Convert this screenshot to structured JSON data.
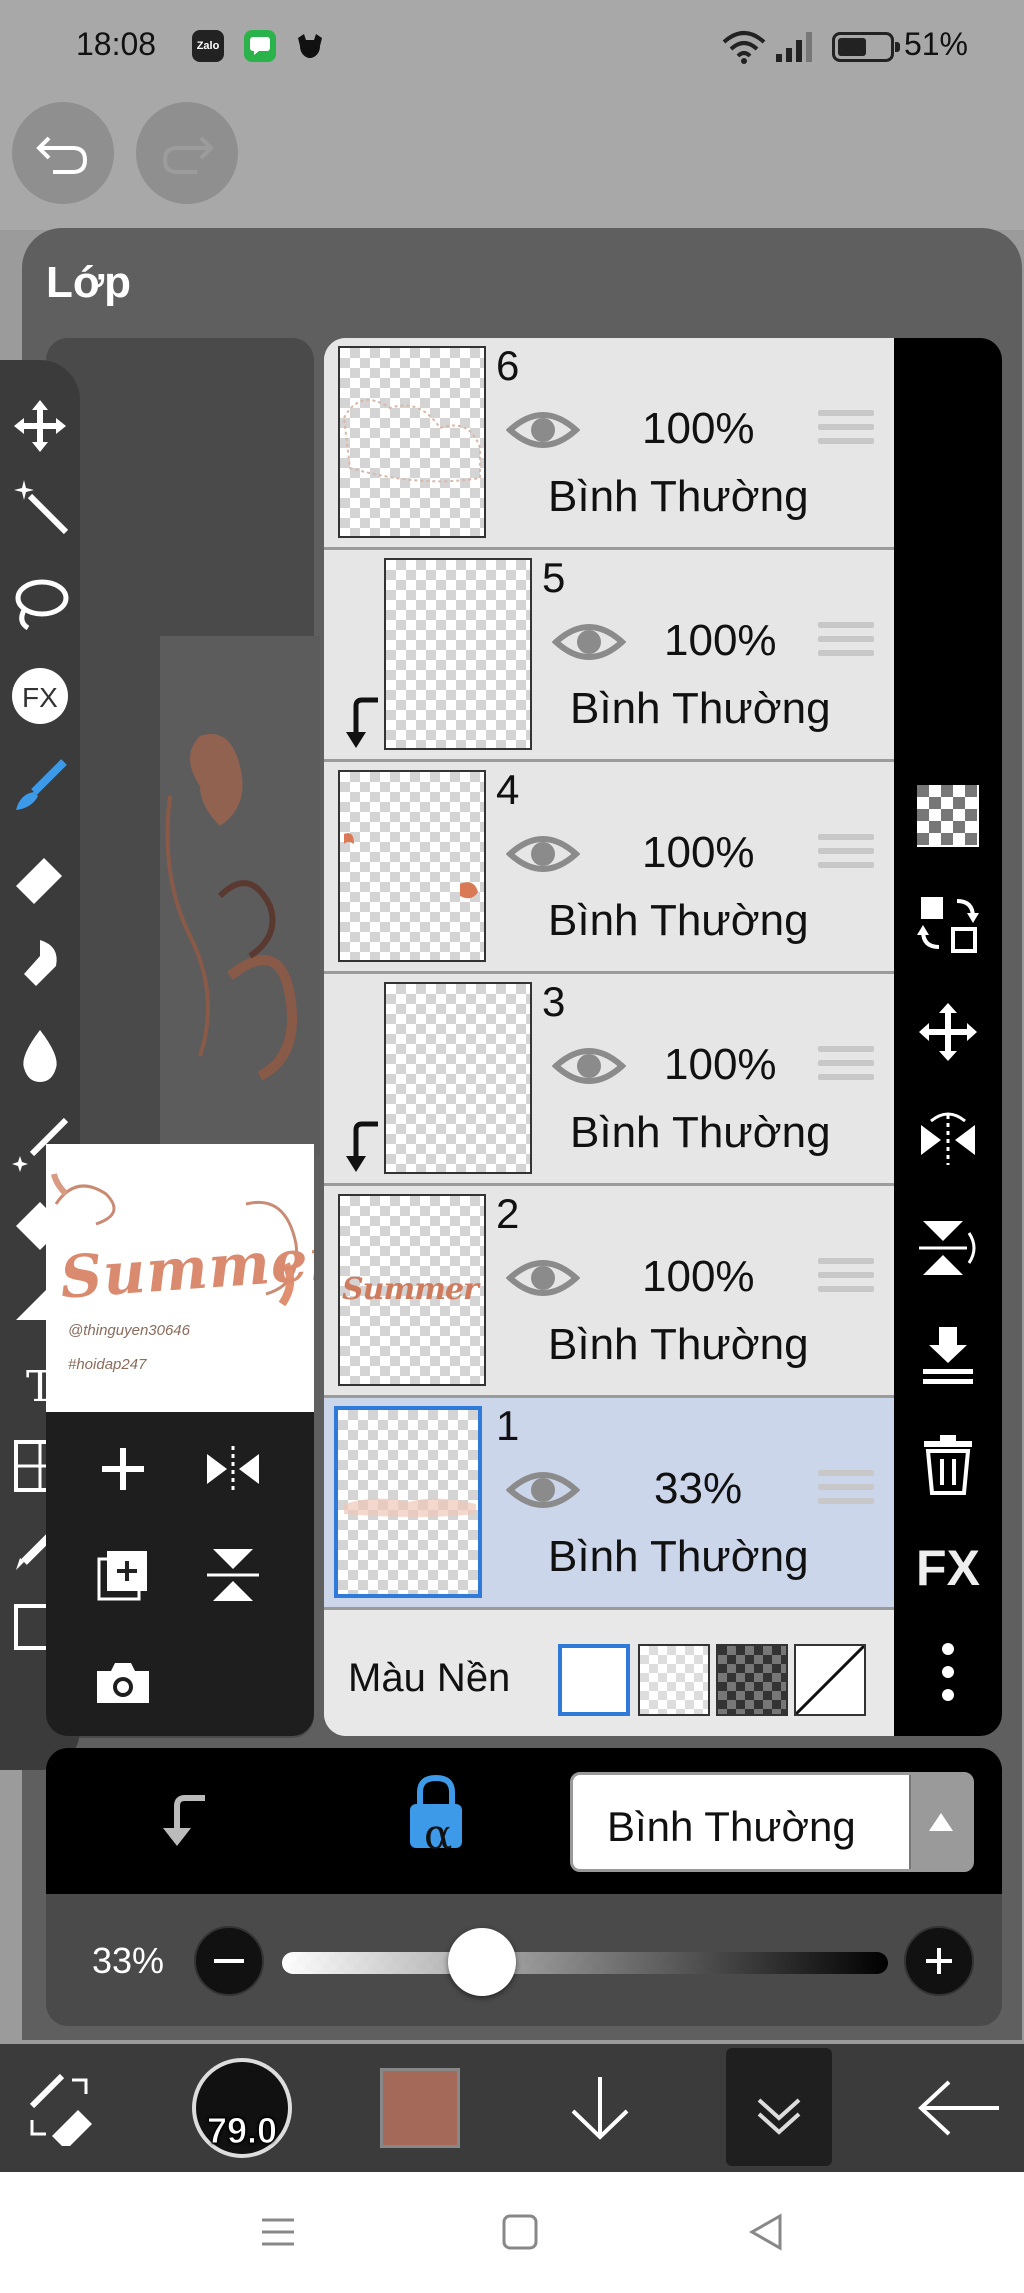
{
  "status": {
    "time": "18:08",
    "apps": [
      "Zalo",
      "msg",
      "pet"
    ],
    "battery": "51%"
  },
  "panel": {
    "title": "Lớp"
  },
  "preview": {
    "thumb_title": "Summer",
    "thumb_line1": "@thinguyen30646",
    "thumb_line2": "#hoidap247"
  },
  "layers": [
    {
      "num": "6",
      "opacity": "100%",
      "blend": "Bình Thường",
      "clipped": false
    },
    {
      "num": "5",
      "opacity": "100%",
      "blend": "Bình Thường",
      "clipped": true
    },
    {
      "num": "4",
      "opacity": "100%",
      "blend": "Bình Thường",
      "clipped": false
    },
    {
      "num": "3",
      "opacity": "100%",
      "blend": "Bình Thường",
      "clipped": true
    },
    {
      "num": "2",
      "opacity": "100%",
      "blend": "Bình Thường",
      "clipped": false,
      "thumb_text": "Summer"
    },
    {
      "num": "1",
      "opacity": "33%",
      "blend": "Bình Thường",
      "clipped": false,
      "selected": true
    }
  ],
  "background": {
    "label": "Màu Nền",
    "swatches": [
      "white",
      "transparent-light",
      "transparent-dark",
      "none"
    ]
  },
  "right_rail": {
    "icons": [
      "checker-icon",
      "swap-icon",
      "move-icon",
      "flip-horizontal-icon",
      "flip-vertical-icon",
      "merge-down-icon",
      "trash-icon",
      "fx-icon",
      "more-icon"
    ],
    "fx_label": "FX"
  },
  "blend_bar": {
    "blend_mode": "Bình Thường",
    "alpha_lock_label": "α"
  },
  "opacity_bar": {
    "label": "33%",
    "value_percent": 33
  },
  "toolbar": {
    "brush_size": "79.0",
    "color": "#a5695a"
  },
  "left_tools": [
    "move-icon",
    "magic-wand-icon",
    "lasso-icon",
    "fx-icon",
    "brush-icon",
    "eraser-icon",
    "smudge-icon",
    "blur-icon",
    "sparkle-brush-icon",
    "fill-icon",
    "gradient-icon",
    "text-icon",
    "frame-icon",
    "pen-icon",
    "canvas-icon"
  ],
  "colors": {
    "accent_blue": "#2f7ad8",
    "selected_row": "#cbd6ea",
    "panel": "#5f5f5f"
  }
}
